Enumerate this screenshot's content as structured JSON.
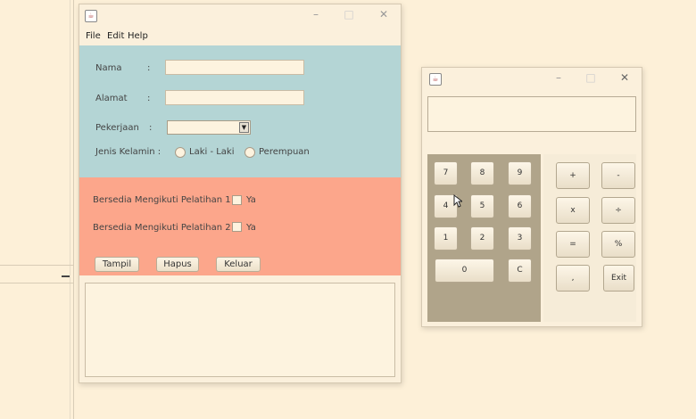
{
  "form_window": {
    "menu": [
      "File",
      "Edit",
      "Help"
    ],
    "fields": {
      "nama_label": "Nama",
      "alamat_label": "Alamat",
      "pekerjaan_label": "Pekerjaan",
      "colon": ":",
      "jenis_kelamin_label": "Jenis Kelamin :",
      "radio_male": "Laki - Laki",
      "radio_female": "Perempuan",
      "nama_value": "",
      "alamat_value": "",
      "pekerjaan_value": ""
    },
    "training": {
      "pelatihan1_label": "Bersedia Mengikuti Pelatihan 1",
      "pelatihan2_label": "Bersedia Mengikuti Pelatihan 2",
      "check_label": "Ya"
    },
    "buttons": {
      "tampil": "Tampil",
      "hapus": "Hapus",
      "keluar": "Keluar"
    },
    "colors": {
      "panel_top": "#b4d5d5",
      "panel_mid": "#fca68b"
    }
  },
  "calculator_window": {
    "display_value": "",
    "keys": {
      "k7": "7",
      "k8": "8",
      "k9": "9",
      "k4": "4",
      "k5": "5",
      "k6": "6",
      "k1": "1",
      "k2": "2",
      "k3": "3",
      "k0": "0",
      "kc": "C",
      "plus": "+",
      "minus": "-",
      "times": "x",
      "divide": "÷",
      "equals": "=",
      "percent": "%",
      "comma": ",",
      "exit": "Exit"
    },
    "colors": {
      "numpad_bg": "#b0a48a"
    }
  },
  "window_controls": {
    "minimize": "–",
    "maximize": "□",
    "close": "✕"
  }
}
